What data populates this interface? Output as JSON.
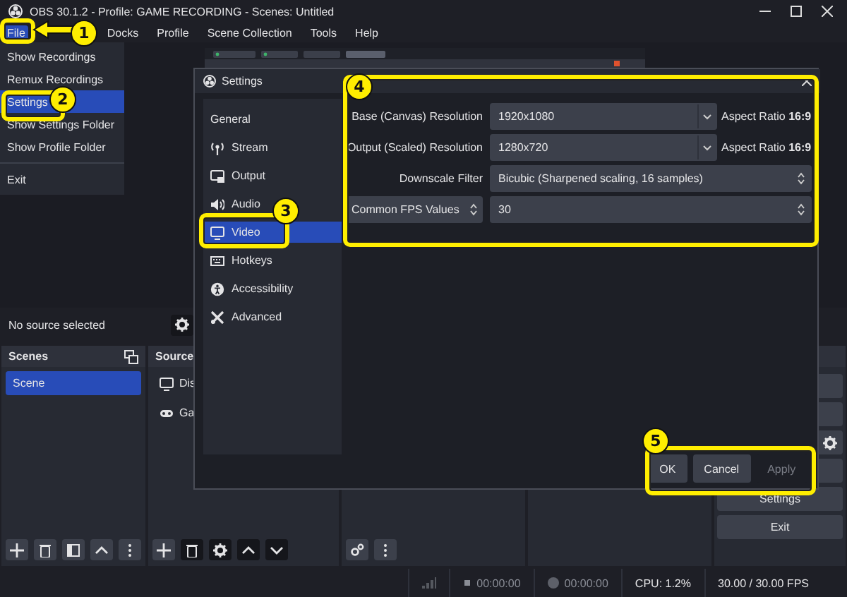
{
  "window": {
    "title": "OBS 30.1.2 - Profile: GAME RECORDING - Scenes: Untitled"
  },
  "menu_bar": [
    {
      "label": "File",
      "selected": true
    },
    {
      "label": "Docks",
      "selected": false
    },
    {
      "label": "Profile",
      "selected": false
    },
    {
      "label": "Scene Collection",
      "selected": false
    },
    {
      "label": "Tools",
      "selected": false
    },
    {
      "label": "Help",
      "selected": false
    }
  ],
  "file_menu": {
    "items": [
      {
        "label": "Show Recordings",
        "selected": false
      },
      {
        "label": "Remux Recordings",
        "selected": false
      },
      {
        "label": "Settings",
        "selected": true
      },
      {
        "label": "Show Settings Folder",
        "selected": false
      },
      {
        "label": "Show Profile Folder",
        "selected": false
      }
    ],
    "footer_items": [
      {
        "label": "Exit",
        "selected": false
      }
    ]
  },
  "preview": {
    "status": "No source selected"
  },
  "scenes": {
    "title": "Scenes",
    "items": [
      {
        "label": "Scene",
        "selected": true
      }
    ]
  },
  "sources": {
    "title": "Source",
    "items": [
      {
        "label": "Dis",
        "kind": "display"
      },
      {
        "label": "Ga",
        "kind": "game"
      }
    ]
  },
  "controls": {
    "buttons": [
      "Settings",
      "Exit"
    ]
  },
  "status_bar": {
    "stream_time": "00:00:00",
    "record_time": "00:00:00",
    "cpu": "CPU: 1.2%",
    "fps": "30.00 / 30.00 FPS"
  },
  "settings": {
    "title": "Settings",
    "sidebar": [
      {
        "label": "General",
        "kind": "general",
        "selected": false
      },
      {
        "label": "Stream",
        "kind": "stream",
        "selected": false
      },
      {
        "label": "Output",
        "kind": "output",
        "selected": false
      },
      {
        "label": "Audio",
        "kind": "audio",
        "selected": false
      },
      {
        "label": "Video",
        "kind": "video",
        "selected": true
      },
      {
        "label": "Hotkeys",
        "kind": "hotkeys",
        "selected": false
      },
      {
        "label": "Accessibility",
        "kind": "accessibility",
        "selected": false
      },
      {
        "label": "Advanced",
        "kind": "advanced",
        "selected": false
      }
    ],
    "rows": [
      {
        "label": "Base (Canvas) Resolution",
        "kind": "combo",
        "value": "1920x1080",
        "aspect": "Aspect Ratio **16:9**"
      },
      {
        "label": "Output (Scaled) Resolution",
        "kind": "combo",
        "value": "1280x720",
        "aspect": "Aspect Ratio **16:9**"
      },
      {
        "label": "Downscale Filter",
        "kind": "select",
        "value": "Bicubic (Sharpened scaling, 16 samples)"
      },
      {
        "label": "Common FPS Values",
        "kind": "fps",
        "value": "30"
      }
    ],
    "buttons": [
      {
        "label": "OK",
        "disabled": false
      },
      {
        "label": "Cancel",
        "disabled": false
      },
      {
        "label": "Apply",
        "disabled": true
      }
    ]
  },
  "annotations": [
    {
      "label": "1"
    },
    {
      "label": "2"
    },
    {
      "label": "3"
    },
    {
      "label": "4"
    },
    {
      "label": "5"
    }
  ]
}
